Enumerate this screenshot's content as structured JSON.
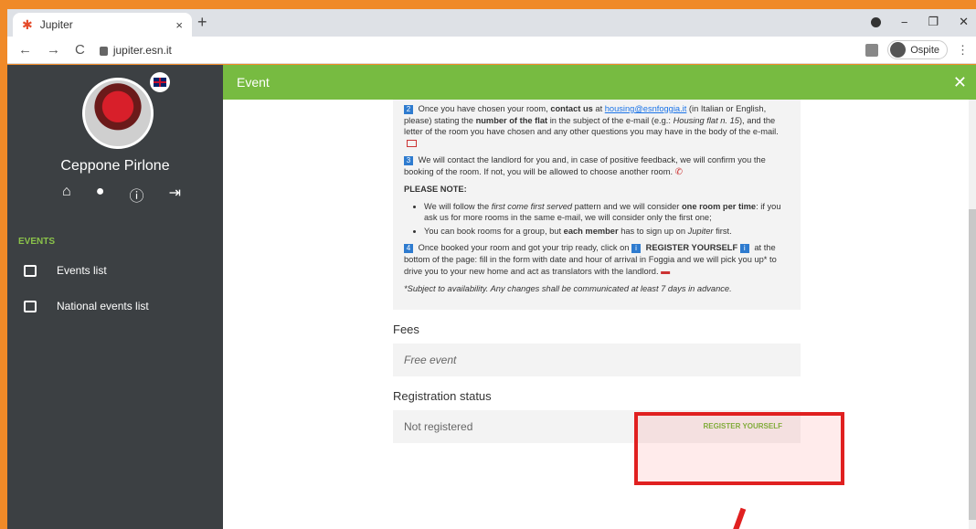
{
  "browser": {
    "tab_title": "Jupiter",
    "tab_close": "×",
    "new_tab": "+",
    "url": "jupiter.esn.it",
    "profile_label": "Ospite",
    "back": "←",
    "forward": "→",
    "reload": "C",
    "menu": "⋮",
    "minimize": "−",
    "maximize": "❐",
    "close": "✕"
  },
  "sidebar": {
    "user_name": "Ceppone Pirlone",
    "section_title": "EVENTS",
    "items": [
      {
        "label": "Events list"
      },
      {
        "label": "National events list"
      }
    ]
  },
  "header": {
    "title": "Event",
    "close": "✕"
  },
  "info": {
    "step2_a": "Once you have chosen your room,",
    "step2_b": "contact us",
    "step2_c": "at",
    "email": "housing@esnfoggia.it",
    "step2_d": "(in Italian or English, please) stating the",
    "step2_e": "number of the flat",
    "step2_f": "in the subject of the e-mail (e.g.:",
    "step2_g": "Housing flat n. 15",
    "step2_h": "), and the letter of the room you have chosen and any other questions you may have in the body of the e-mail.",
    "step3": "We will contact the landlord for you and, in case of positive feedback, we will confirm you the booking of the room. If not, you will be allowed to choose another room.",
    "note_title": "PLEASE NOTE:",
    "note1_a": "We will follow the",
    "note1_b": "first come first served",
    "note1_c": "pattern and we will consider",
    "note1_d": "one room per time",
    "note1_e": ": if you ask us for more rooms in the same e-mail, we will consider only the first one;",
    "note2_a": "You can book rooms for a group, but",
    "note2_b": "each member",
    "note2_c": "has to sign up on",
    "note2_d": "Jupiter",
    "note2_e": "first.",
    "step4_a": "Once booked your room and got your trip ready, click on",
    "step4_b": "REGISTER YOURSELF",
    "step4_c": "at the bottom of the page: fill in the form with date and hour of arrival in Foggia and we will pick you up* to drive you to your new home and act as translators with the landlord.",
    "footnote": "*Subject to availability. Any changes shall be communicated at least 7 days in advance.",
    "n2": "2",
    "n3": "3",
    "n4": "4",
    "ni": "i"
  },
  "fees": {
    "heading": "Fees",
    "value": "Free event"
  },
  "registration": {
    "heading": "Registration status",
    "status": "Not registered",
    "button": "REGISTER YOURSELF"
  }
}
